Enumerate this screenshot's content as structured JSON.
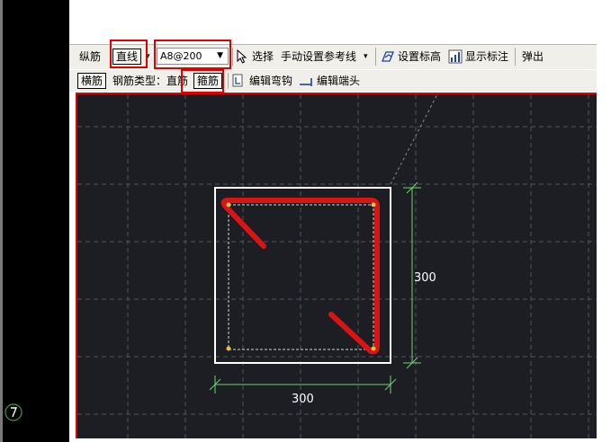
{
  "toolbar_row1": {
    "longitudinal_label": "纵筋",
    "line_button": "直线",
    "rebar_spec": "A8@200",
    "select_label": "选择",
    "manual_refline_label": "手动设置参考线",
    "set_elevation_label": "设置标高",
    "show_dimension_label": "显示标注",
    "popup_label": "弹出"
  },
  "toolbar_row2": {
    "transverse_button": "横筋",
    "rebar_type_label": "钢筋类型：",
    "straight_option": "直筋",
    "stirrup_button": "箍筋",
    "edit_hook_label": "编辑弯钩",
    "edit_end_label": "编辑端头"
  },
  "drawing": {
    "dim_vertical": "300",
    "dim_horizontal": "300"
  },
  "colors": {
    "canvas_bg": "#1d1d24",
    "rebar_red": "#d81414",
    "dimension_green": "#6fd36f",
    "highlight_red": "#e00000"
  }
}
